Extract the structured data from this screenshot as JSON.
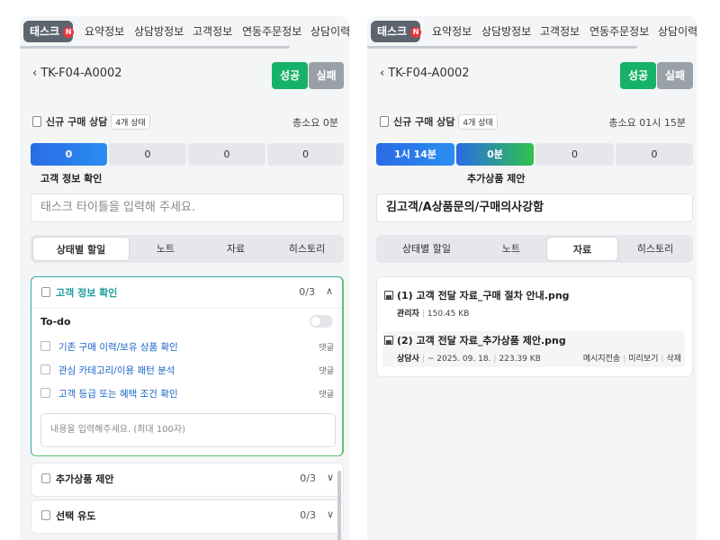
{
  "tabs": {
    "task": "태스크",
    "badge": "N",
    "summary": "요약정보",
    "counsel": "상담방정보",
    "customer": "고객정보",
    "linked_order": "연동주문정보",
    "history": "상담이력"
  },
  "left": {
    "ticket_id": "TK-F04-A0002",
    "success": "성공",
    "fail": "실패",
    "consult_type": "신규 구매 상담",
    "state_count": "4개 상태",
    "total_time": "총소요 0분",
    "segments": [
      "0",
      "0",
      "0",
      "0"
    ],
    "stage_label": "고객 정보 확인",
    "title_placeholder": "태스크 타이틀을 입력해 주세요.",
    "subtabs": [
      "상태별 할일",
      "노트",
      "자료",
      "히스토리"
    ],
    "open_section": {
      "title": "고객 정보 확인",
      "count": "0/3",
      "todo_label": "To-do",
      "items": [
        {
          "text": "기존 구매 이력/보유 상품 확인",
          "comment": "댓글"
        },
        {
          "text": "관심 카테고리/이용 패턴 분석",
          "comment": "댓글"
        },
        {
          "text": "고객 등급 또는 혜택 조건 확인",
          "comment": "댓글"
        }
      ],
      "memo_placeholder": "내용을 입력해주세요. (최대 100자)"
    },
    "sections": [
      {
        "title": "추가상품 제안",
        "count": "0/3"
      },
      {
        "title": "선택 유도",
        "count": "0/3"
      }
    ]
  },
  "right": {
    "ticket_id": "TK-F04-A0002",
    "success": "성공",
    "fail": "실패",
    "consult_type": "신규 구매 상담",
    "state_count": "4개 상태",
    "total_time": "총소요 01시 15분",
    "segments": [
      "1시 14분",
      "0분",
      "0",
      "0"
    ],
    "stage_label": "추가상품 제안",
    "title_value": "김고객/A상품문의/구매의사강함",
    "subtabs": [
      "상태별 할일",
      "노트",
      "자료",
      "히스토리"
    ],
    "files": [
      {
        "name": "(1) 고객 전달 자료_구매 절차 안내.png",
        "uploader": "관리자",
        "size": "150.45 KB"
      },
      {
        "name": "(2) 고객 전달 자료_추가상품 제안.png",
        "uploader": "상담사",
        "date": "~ 2025. 09. 18.",
        "size": "223.39 KB",
        "actions": [
          "메시지전송",
          "미리보기",
          "삭제"
        ]
      }
    ]
  },
  "colors": {
    "success": "#17b26a",
    "fail": "#9aa0a8",
    "active_tab": "#5c6470",
    "badge": "#e8383d",
    "link": "#1b64c7",
    "progress_blue": "#2b6be6"
  }
}
